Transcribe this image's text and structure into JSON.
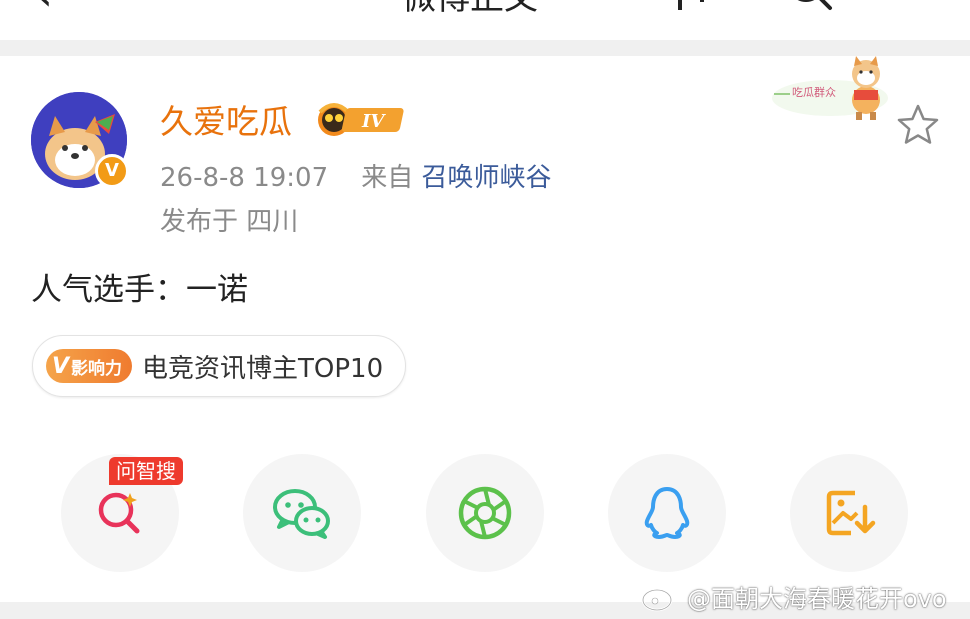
{
  "header": {
    "back_icon": "back-arrow-icon",
    "title": "微博正文",
    "more_icon": "more-icon",
    "search_icon": "search-icon"
  },
  "post": {
    "author": {
      "name": "久爱吃瓜",
      "avatar": "shiba-avatar",
      "verified_badge": "V",
      "level_badge": "IV",
      "name_color": "#e8720c"
    },
    "timestamp": "26-8-8 19:07",
    "source_prefix": "来自",
    "source": "召唤师峡谷",
    "location": "发布于 四川",
    "decoration_text": "吃瓜群众",
    "text": "人气选手：一诺",
    "influence": {
      "badge_v": "V",
      "badge_label": "影响力",
      "title": "电竞资讯博主TOP10"
    }
  },
  "share_bar": {
    "items": [
      {
        "name": "ask-search",
        "icon": "ask-search-icon",
        "tag": "问智搜",
        "color": "#e8335a"
      },
      {
        "name": "wechat",
        "icon": "wechat-icon",
        "color": "#3cbf7a"
      },
      {
        "name": "moments",
        "icon": "moments-icon",
        "color": "#5cc14b"
      },
      {
        "name": "qq",
        "icon": "qq-icon",
        "color": "#3a9ff0"
      },
      {
        "name": "save-image",
        "icon": "save-image-icon",
        "color": "#f4a522"
      }
    ]
  },
  "watermark": {
    "icon": "weibo-logo-icon",
    "text": "@面朝大海春暖花开ovo"
  }
}
